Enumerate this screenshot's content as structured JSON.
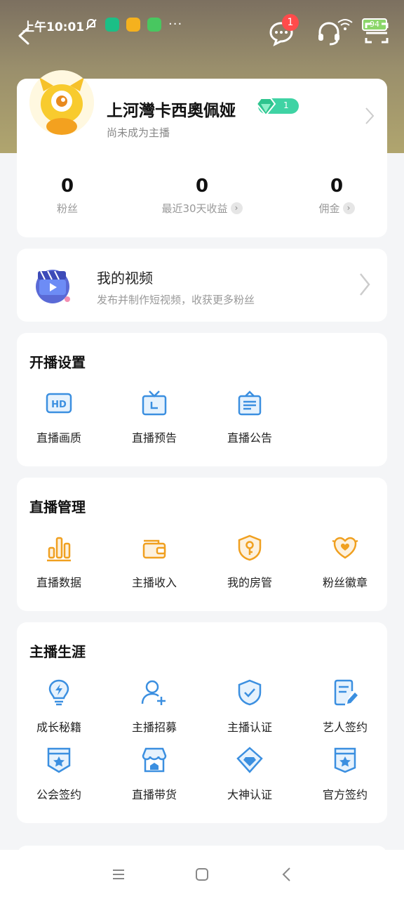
{
  "status_bar": {
    "time": "上午10:01",
    "dots": "···",
    "battery": "94"
  },
  "header": {
    "message_badge": "1"
  },
  "profile": {
    "username": "上河灣卡西奧佩娅",
    "level": "1",
    "subtitle": "尚未成为主播",
    "stats": [
      {
        "value": "0",
        "label": "粉丝"
      },
      {
        "value": "0",
        "label": "最近30天收益"
      },
      {
        "value": "0",
        "label": "佣金"
      }
    ]
  },
  "my_video": {
    "title": "我的视频",
    "description": "发布并制作短视频，收获更多粉丝"
  },
  "broadcast_settings": {
    "title": "开播设置",
    "items": [
      {
        "label": "直播画质",
        "icon": "hd-icon"
      },
      {
        "label": "直播预告",
        "icon": "tv-icon"
      },
      {
        "label": "直播公告",
        "icon": "notice-icon"
      }
    ]
  },
  "live_management": {
    "title": "直播管理",
    "items": [
      {
        "label": "直播数据",
        "icon": "bar-chart-icon"
      },
      {
        "label": "主播收入",
        "icon": "wallet-icon"
      },
      {
        "label": "我的房管",
        "icon": "key-shield-icon"
      },
      {
        "label": "粉丝徽章",
        "icon": "heart-badge-icon"
      }
    ]
  },
  "anchor_career": {
    "title": "主播生涯",
    "items": [
      {
        "label": "成长秘籍",
        "icon": "lightbulb-icon"
      },
      {
        "label": "主播招募",
        "icon": "add-user-icon"
      },
      {
        "label": "主播认证",
        "icon": "shield-check-icon"
      },
      {
        "label": "艺人签约",
        "icon": "edit-doc-icon"
      },
      {
        "label": "公会签约",
        "icon": "star-shield-icon"
      },
      {
        "label": "直播带货",
        "icon": "store-icon"
      },
      {
        "label": "大神认证",
        "icon": "diamond-badge-icon"
      },
      {
        "label": "官方签约",
        "icon": "star-doc-icon"
      }
    ]
  },
  "colors": {
    "blue_icon": "#3b8fe0",
    "orange_icon": "#f0a020",
    "level_badge": "#3fd3a4"
  }
}
